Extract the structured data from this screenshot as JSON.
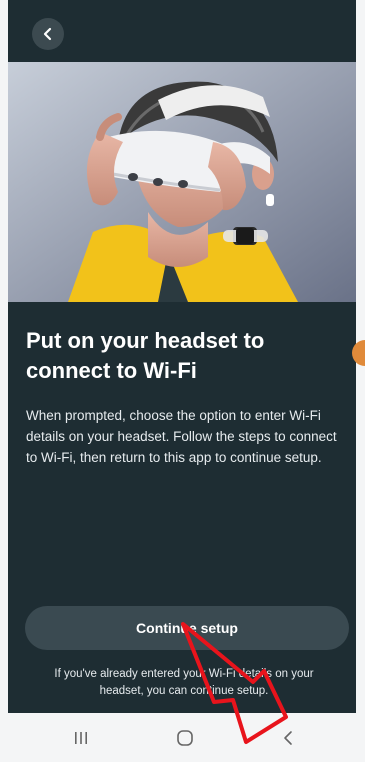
{
  "screen": {
    "title": "Put on your headset to connect to Wi-Fi",
    "body": "When prompted, choose the option to enter Wi-Fi details on your headset. Follow the steps to connect to Wi-Fi, then return to this app to continue setup.",
    "continue_label": "Continue setup",
    "footnote": "If you've already entered your Wi-Fi details on your headset, you can continue setup."
  },
  "icons": {
    "back": "chevron-left-icon",
    "nav_recents": "recents-icon",
    "nav_home": "home-icon",
    "nav_back": "back-icon"
  },
  "colors": {
    "background": "#1e2d33",
    "button": "#3a4a51",
    "text": "#ffffff",
    "annotation_arrow": "#e8141c",
    "navbar": "#f4f5f6"
  }
}
